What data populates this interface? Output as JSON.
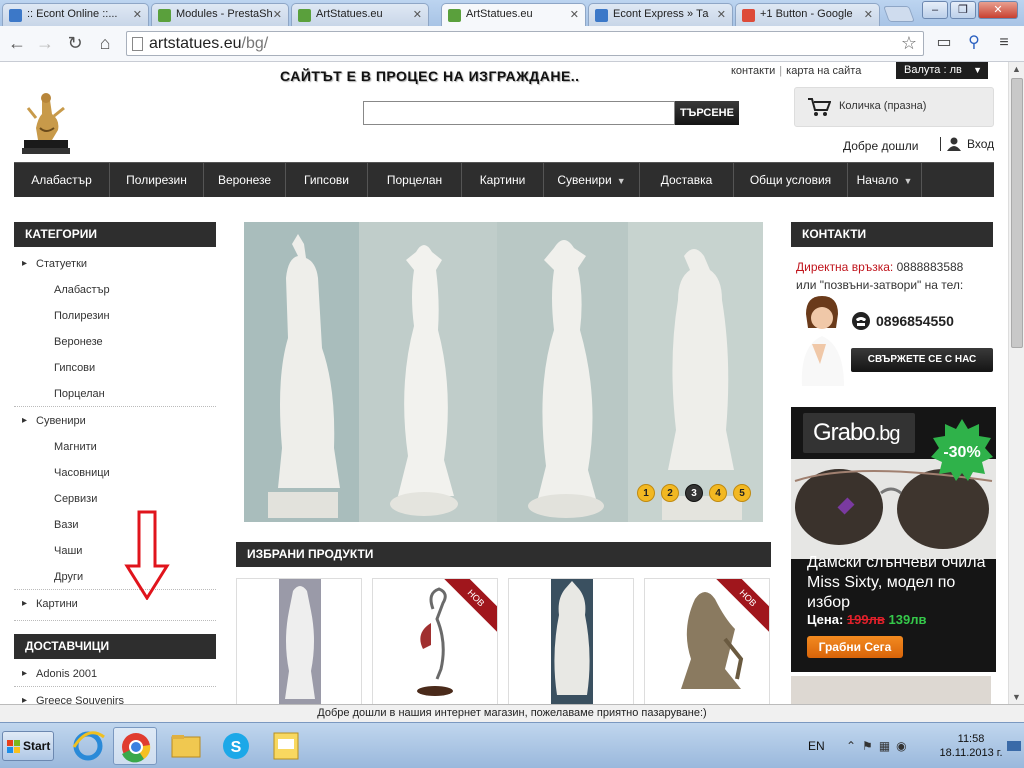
{
  "browser": {
    "tabs": [
      {
        "title": ":: Econt Online ::...",
        "color": "#3c78c8"
      },
      {
        "title": "Modules - PrestaSh",
        "color": "#5aa03c"
      },
      {
        "title": "ArtStatues.eu",
        "color": "#5aa03c"
      },
      {
        "title": "ArtStatues.eu",
        "color": "#5aa03c"
      },
      {
        "title": "Econt Express » Та",
        "color": "#3c78c8"
      },
      {
        "title": "+1 Button - Google",
        "color": "#dd4b39"
      }
    ],
    "url_domain": "artstatues.eu",
    "url_path": "/bg/"
  },
  "header": {
    "construction_notice": "САЙТЪТ Е В ПРОЦЕС НА ИЗГРАЖДАНЕ..",
    "top_links": [
      "контакти",
      "карта на сайта"
    ],
    "currency": "Валута : лв",
    "search_button": "ТЪРСЕНЕ",
    "cart_label": "Количка (празна)",
    "welcome": "Добре дошли",
    "login": "Вход"
  },
  "main_nav": [
    {
      "label": "Алабастър",
      "dropdown": false,
      "w": 96
    },
    {
      "label": "Полирезин",
      "dropdown": false,
      "w": 94
    },
    {
      "label": "Веронезе",
      "dropdown": false,
      "w": 82
    },
    {
      "label": "Гипсови",
      "dropdown": false,
      "w": 82
    },
    {
      "label": "Порцелан",
      "dropdown": false,
      "w": 94
    },
    {
      "label": "Картини",
      "dropdown": false,
      "w": 82
    },
    {
      "label": "Сувенири",
      "dropdown": true,
      "w": 96
    },
    {
      "label": "Доставка",
      "dropdown": false,
      "w": 94
    },
    {
      "label": "Общи условия",
      "dropdown": false,
      "w": 114
    },
    {
      "label": "Начало",
      "dropdown": true,
      "w": 74
    }
  ],
  "categories": {
    "title": "КАТЕГОРИИ",
    "groups": [
      {
        "label": "Статуетки",
        "children": [
          "Алабастър",
          "Полирезин",
          "Веронезе",
          "Гипсови",
          "Порцелан"
        ]
      },
      {
        "label": "Сувенири",
        "children": [
          "Магнити",
          "Часовници",
          "Сервизи",
          "Вази",
          "Чаши",
          "Други"
        ]
      },
      {
        "label": "Картини",
        "children": []
      }
    ]
  },
  "suppliers": {
    "title": "ДОСТАВЧИЦИ",
    "items": [
      "Adonis 2001",
      "Greece Souvenirs"
    ]
  },
  "slider": {
    "dots": [
      "1",
      "2",
      "3",
      "4",
      "5"
    ],
    "active_index": 2
  },
  "featured": {
    "title": "ИЗБРАНИ ПРОДУКТИ",
    "ribbon_label": "НОВ",
    "products": [
      {
        "new": false
      },
      {
        "new": true
      },
      {
        "new": false
      },
      {
        "new": true
      }
    ]
  },
  "contacts": {
    "title": "КОНТАКТИ",
    "direct_label": "Директна връзка:",
    "direct_number": "0888883588",
    "callback_text": "или \"позвъни-затвори\" на тел:",
    "phone": "0896854550",
    "contact_button": "СВЪРЖЕТЕ СЕ С НАС"
  },
  "ad": {
    "brand": "Grabo",
    "brand_suffix": ".bg",
    "discount": "-30%",
    "text": "Дамски слънчеви очила Miss Sixty, модел по избор",
    "price_label": "Цена:",
    "old_price": "199лв",
    "new_price": "139лв",
    "button": "Грабни Сега"
  },
  "status_message": "Добре дошли в нашия интернет магазин, пожелаваме приятно пазаруване:)",
  "taskbar": {
    "start": "Start",
    "language": "EN",
    "time": "11:58",
    "date": "18.11.2013 г."
  }
}
